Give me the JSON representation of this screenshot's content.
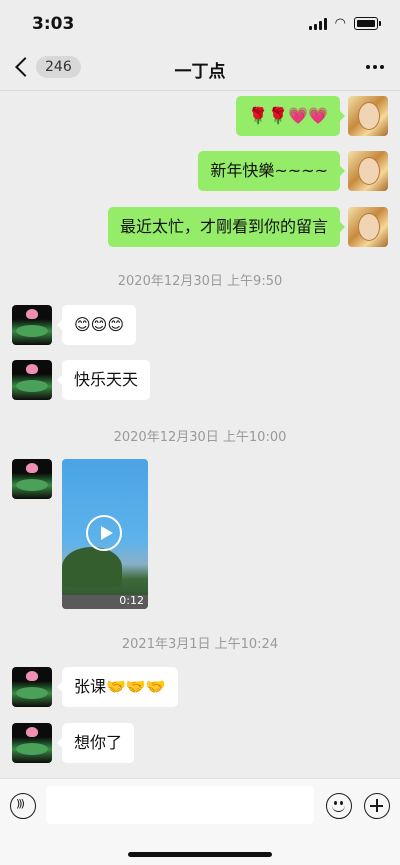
{
  "status_bar": {
    "time": "3:03"
  },
  "nav": {
    "back_badge": "246",
    "title": "一丁点",
    "more_icon": "more-dots-icon"
  },
  "messages": [
    {
      "type": "text",
      "from": "me",
      "text": "🌹🌹💗💗"
    },
    {
      "type": "text",
      "from": "me",
      "text": "新年快樂~~~~"
    },
    {
      "type": "text",
      "from": "me",
      "text": "最近太忙，才剛看到你的留言"
    },
    {
      "type": "timestamp",
      "text": "2020年12月30日 上午9:50"
    },
    {
      "type": "text",
      "from": "other",
      "text": "😊😊😊"
    },
    {
      "type": "text",
      "from": "other",
      "text": "快乐天天"
    },
    {
      "type": "timestamp",
      "text": "2020年12月30日 上午10:00"
    },
    {
      "type": "video",
      "from": "other",
      "duration": "0:12"
    },
    {
      "type": "timestamp",
      "text": "2021年3月1日 上午10:24"
    },
    {
      "type": "text",
      "from": "other",
      "text": "张课🤝🤝🤝"
    },
    {
      "type": "text",
      "from": "other",
      "text": "想你了"
    }
  ],
  "input_bar": {
    "voice_icon": "voice-icon",
    "emoji_icon": "emoji-icon",
    "plus_icon": "plus-icon",
    "input_value": ""
  }
}
